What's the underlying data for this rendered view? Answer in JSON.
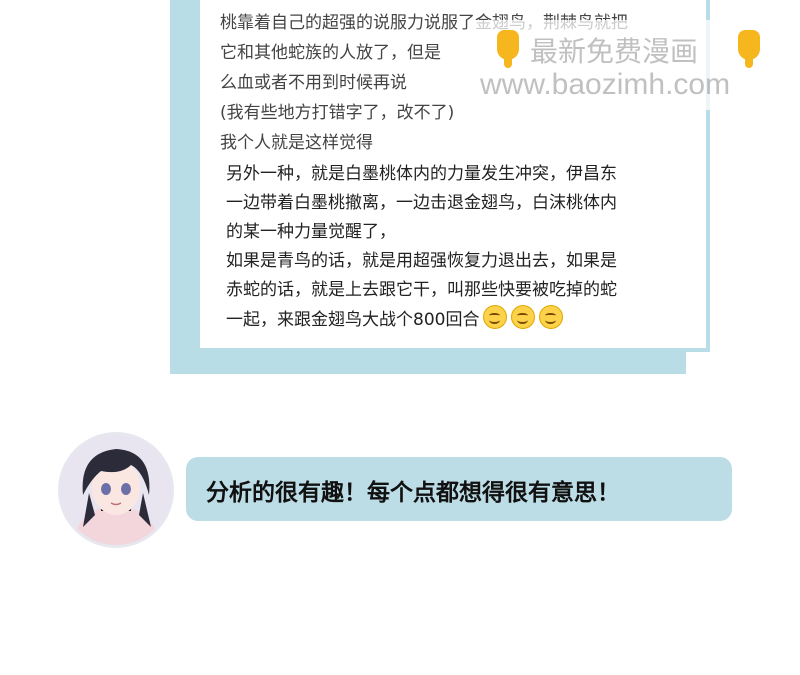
{
  "comment": {
    "lines": [
      "桃靠着自己的超强的说服力说服了金翅鸟，荆棘鸟就把",
      "它和其他蛇族的人放了，但是",
      "么血或者不用到时候再说",
      "(我有些地方打错字了，改不了)",
      "我个人就是这样觉得"
    ]
  },
  "reply": {
    "lines": [
      "另外一种，就是白墨桃体内的力量发生冲突，伊昌东",
      "一边带着白墨桃撤离，一边击退金翅鸟，白沫桃体内",
      "的某一种力量觉醒了，",
      "如果是青鸟的话，就是用超强恢复力退出去，如果是",
      "赤蛇的话，就是上去跟它干，叫那些快要被吃掉的蛇",
      "一起，来跟金翅鸟大战个800回合"
    ],
    "emoji_count": 3,
    "emoji_icon": "smiling-face-icon"
  },
  "watermark": {
    "title": "最新免费漫画",
    "url": "www.baozimh.com",
    "icon": "pointing-down-hand-icon"
  },
  "response": {
    "text": "分析的很有趣！每个点都想得很有意思！"
  },
  "colors": {
    "accent": "#b9dde6",
    "bubble": "#bcdde5",
    "hair": "#2b2b3a"
  }
}
